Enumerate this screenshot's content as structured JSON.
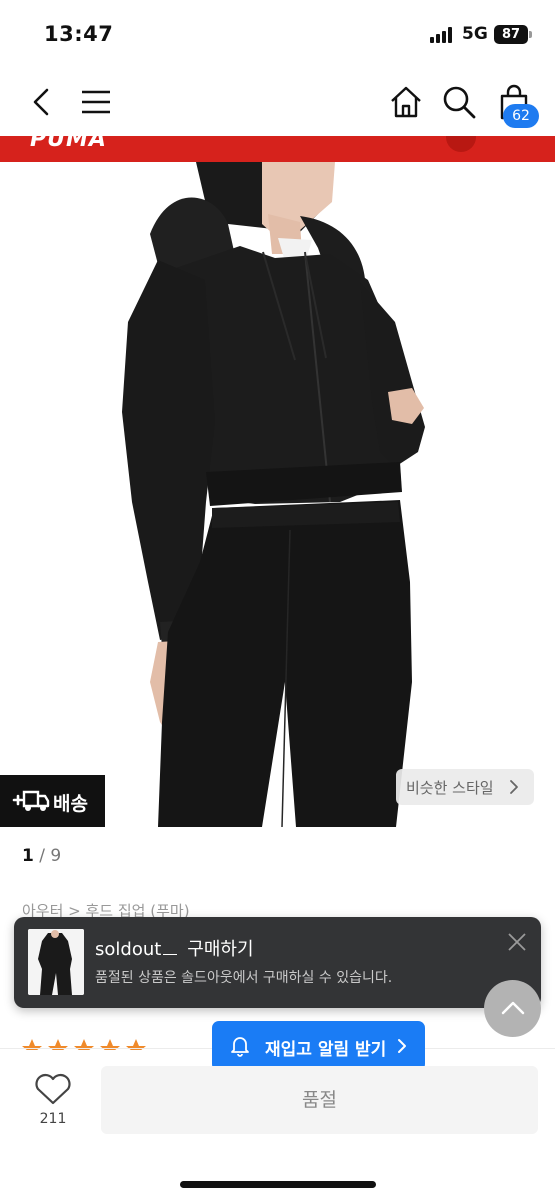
{
  "status_bar": {
    "time": "13:47",
    "network": "5G",
    "battery": "87"
  },
  "nav": {
    "cart_count": "62"
  },
  "hero": {
    "brand_text": "PUMA",
    "delivery_label": "배송",
    "similar_style_label": "비슷한 스타일"
  },
  "pager": {
    "current": "1",
    "separator": " / ",
    "total": "9"
  },
  "breadcrumb": "아우터 > 후드 집업 (푸마)",
  "popup": {
    "brand": "soldout",
    "action": "구매하기",
    "description": "품절된 상품은 솔드아웃에서 구매하실 수 있습니다."
  },
  "restock": {
    "label": "재입고 알림 받기"
  },
  "bottom_bar": {
    "like_count": "211",
    "soldout_label": "품절"
  },
  "colors": {
    "accent": "#1a7cf5",
    "brand_red": "#d6221c",
    "popup_bg": "#333436"
  },
  "icons": [
    "back-icon",
    "menu-icon",
    "home-icon",
    "search-icon",
    "cart-icon",
    "truck-icon",
    "chevron-right-icon",
    "close-icon",
    "bell-icon",
    "heart-icon",
    "arrow-up-icon"
  ]
}
